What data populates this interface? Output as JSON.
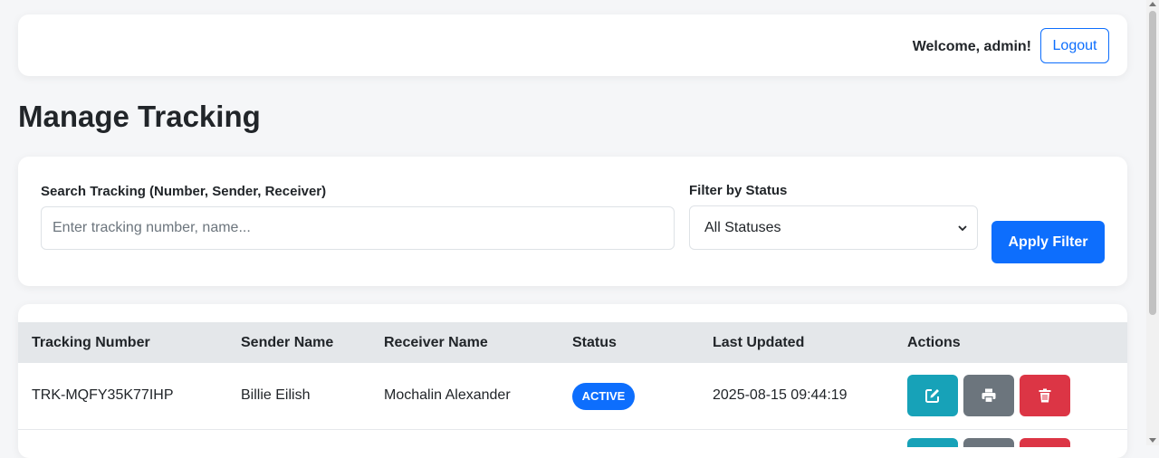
{
  "header": {
    "welcome_text": "Welcome, admin!",
    "logout_label": "Logout"
  },
  "page": {
    "title": "Manage Tracking"
  },
  "filters": {
    "search_label": "Search Tracking (Number, Sender, Receiver)",
    "search_placeholder": "Enter tracking number, name...",
    "search_value": "",
    "status_label": "Filter by Status",
    "status_selected": "All Statuses",
    "apply_label": "Apply Filter"
  },
  "table": {
    "columns": [
      "Tracking Number",
      "Sender Name",
      "Receiver Name",
      "Status",
      "Last Updated",
      "Actions"
    ],
    "rows": [
      {
        "tracking_number": "TRK-MQFY35K77IHP",
        "sender": "Billie Eilish",
        "receiver": "Mochalin Alexander",
        "status": "ACTIVE",
        "last_updated": "2025-08-15 09:44:19",
        "actions": [
          "edit-icon",
          "print-icon",
          "trash-icon"
        ]
      }
    ]
  },
  "colors": {
    "primary": "#0d6efd",
    "edit": "#17a2b8",
    "print": "#6c757d",
    "delete": "#dc3545",
    "background": "#f5f6f8",
    "table_header": "#e4e7ea"
  }
}
